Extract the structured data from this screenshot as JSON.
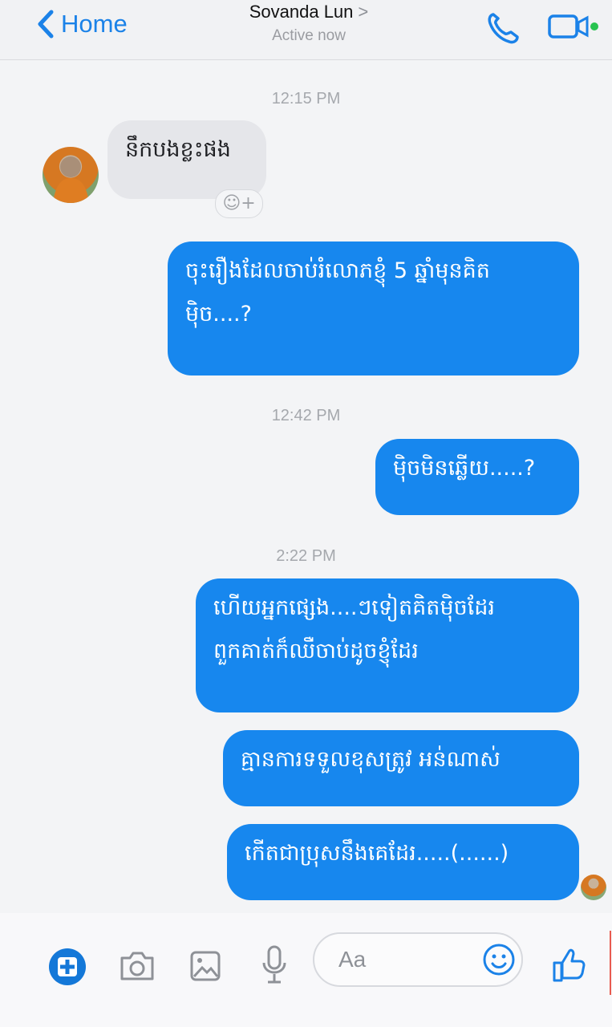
{
  "header": {
    "back_label": "Home",
    "contact_name": "Sovanda Lun",
    "contact_chevron": ">",
    "status": "Active now",
    "call_icon": "phone-icon",
    "video_icon": "video-camera-icon"
  },
  "messages": [
    {
      "type": "timestamp",
      "text": "12:15 PM"
    },
    {
      "type": "incoming",
      "text": "នឹកបងខ្លះផង",
      "reaction": "☺+"
    },
    {
      "type": "outgoing",
      "lines": [
        "ចុះរឿងដែលចាប់រំលោភខ្ញុំ 5 ឆ្នាំមុនគិត",
        "ម៉ិច....?"
      ]
    },
    {
      "type": "timestamp",
      "text": "12:42 PM"
    },
    {
      "type": "outgoing",
      "text": "ម៉ិចមិនឆ្លើយ.....?"
    },
    {
      "type": "timestamp",
      "text": "2:22 PM"
    },
    {
      "type": "outgoing",
      "lines": [
        "ហើយអ្នកផ្សេង....ៗទៀតគិតម៉ិចដែរ",
        "ពួកគាត់ក៏ឈឺចាប់ដូចខ្ញុំដែរ"
      ]
    },
    {
      "type": "outgoing",
      "text": "គ្មានការទទួលខុសត្រូវ អន់ណាស់"
    },
    {
      "type": "outgoing",
      "text": "កើតជាប្រុសនឹងគេដែរ.....(......)"
    }
  ],
  "composer": {
    "placeholder": "Aa",
    "icons": [
      "plus-icon",
      "camera-icon",
      "photo-icon",
      "microphone-icon",
      "emoji-icon",
      "thumbs-up-icon"
    ]
  },
  "colors": {
    "accent": "#1787ee",
    "incoming_bubble": "#e5e6ea",
    "header_background": "#f1f2f4"
  }
}
